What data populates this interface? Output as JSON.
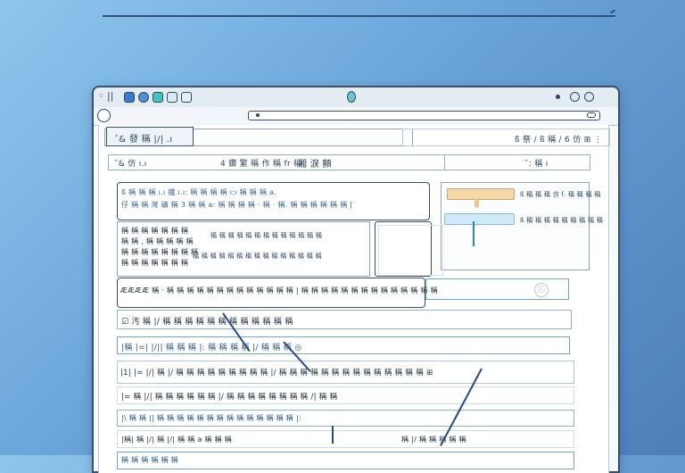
{
  "window": {
    "title_glyph": "◦ ||",
    "traffic_colors": [
      "#3a7bd0",
      "#4a92d9",
      "#43c3bf",
      "#dbe9f3",
      "#e6eef5"
    ]
  },
  "header": {
    "tab_label": "ˆ& 發 稱 |/| .ı",
    "right_text": "ß 祭 / ß 稱 / 6 仿 ⊞ ⋮"
  },
  "toolbar": {
    "left_text": "ˆ& 仿 ı.ı",
    "middle_text": "4 鑽 繁 稱 作 稱 fr 稱",
    "title": "湘 淚 顫",
    "right_text": "ˆ: 稱 ı"
  },
  "query": {
    "line_1": "ß 稱 稱 稱 ı.ı 纖 ı.ı: 稱 稱 稱 稱 ı:ı 稱 稱 稱 a.",
    "line_2": "仔 稱 稱 灣 礦 稱 3 稱 稱 a: 稱 稱 稱 稱 · 稱 ·  稱. 稱 稱 稱 稱 稱 稱 ʃ"
  },
  "side_panel": {
    "label_1": "ß 稱 稱 稱 仿 f. 稱 稱 稱 稱",
    "label_2": "ß 稱 稱 稱 稱 稱 稱 稱 稱 稱"
  },
  "data": {
    "block_lines": [
      "稱 稱 稱 稱 稱 稱 稱",
      "稱 稱 , 稱 稱 稱 稱 稱",
      "稱 稱 稱 稱 稱 稱 稱 稱",
      "稱 稱 稱 稱 稱 稱 稱"
    ],
    "right_1": "稱 稱 稱 稱 稱 稱 稱 稱 稱 稱 稱 稱 稱",
    "right_2": "稱 稱 稱 稱 稱 稱 稱 稱 稱 稱 稱 稱 稱 稱 稱"
  },
  "rows": [
    "ÆÆÆÆ 稱 · 稱 稱 稱 稱 稱 稱 稱 稱 稱 稱 稱 稱 稱 | 稱 稱 稱 稱 稱 稱 稱 稱 稱 稱 稱 稱 稱 稱",
    "☑ 汚 稱 |/ 稱 稱 稱 稱 稱 稱 稱 稱 稱 稱 稱 稱",
    "|稱 |=| |/|| 稱 稱 稱 |: 稱 稱 稱 稱 |/ 稱 稱 稱 ◎",
    "|1| |= |/| 稱 |/ 稱 稱 稱 稱 稱 稱 稱 稱 稱 |/ 稱 稱 稱 稱 稱 稱 稱 稱 稱 稱 稱 稱 稱 稱 ⊞",
    "|= 稱 |/| 稱 稱 稱 稱 稱 稱 |/ 稱 稱 稱 稱 稱 稱 稱 稱 /| 稱 稱",
    "|\\ 稱 稱 || 稱 稱 稱 稱 稱 稱 稱 稱 稱 稱 稱 稱 稱 稱 |:",
    "|稱| 稱 |/| 稱 |/| 稱 稱 ǝ 稱 稱 稱",
    "稱 稱 稱 稱 稱 稱"
  ],
  "rows_right": [
    "稱 |/ 稱 稱 稱 稱 稱",
    "稱 稱 稱"
  ]
}
